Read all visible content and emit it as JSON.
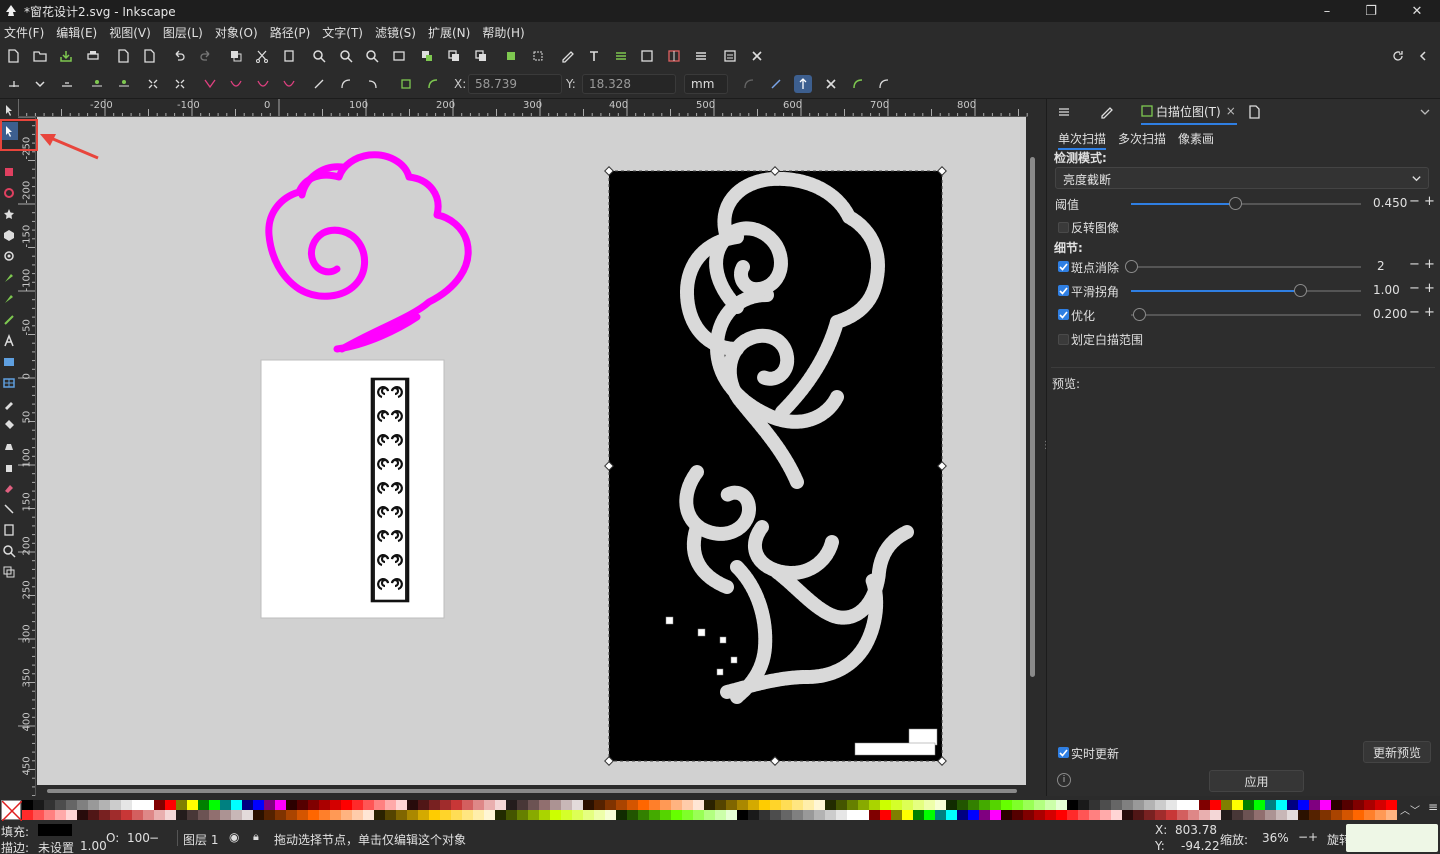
{
  "window": {
    "title": "*窗花设计2.svg - Inkscape",
    "minimize": "–",
    "maximize": "❐",
    "close": "✕"
  },
  "menu": [
    "文件(F)",
    "编辑(E)",
    "视图(V)",
    "图层(L)",
    "对象(O)",
    "路径(P)",
    "文字(T)",
    "滤镜(S)",
    "扩展(N)",
    "帮助(H)"
  ],
  "toolcontrols": {
    "x_label": "X:",
    "x_value": "58.739",
    "y_label": "Y:",
    "y_value": "18.328",
    "unit": "mm"
  },
  "ruler": {
    "h_labels": [
      "-200",
      "-100",
      "0",
      "100",
      "200",
      "300",
      "400",
      "500",
      "600",
      "700",
      "800"
    ],
    "v_labels": [
      "-250",
      "-200",
      "-150",
      "-100",
      "-50",
      "0",
      "50",
      "100",
      "150",
      "200",
      "250",
      "300",
      "350",
      "400",
      "450"
    ]
  },
  "panel": {
    "tabs": [
      "描图",
      "填充与描边",
      "白描位图(T)"
    ],
    "active_tab": "白描位图(T)",
    "tab_close": "×",
    "subtabs": [
      "单次扫描",
      "多次扫描",
      "像素画"
    ],
    "detection_mode_label": "检测模式:",
    "detection_mode_value": "亮度截断",
    "threshold_label": "阈值",
    "threshold_value": "0.450",
    "threshold_level": 0.45,
    "invert_label": "反转图像",
    "invert_checked": false,
    "details_label": "细节:",
    "speckles_label": "斑点消除",
    "speckles_checked": true,
    "speckles_value": "2",
    "smooth_label": "平滑拐角",
    "smooth_checked": true,
    "smooth_value": "1.00",
    "optimize_label": "优化",
    "optimize_checked": true,
    "optimize_value": "0.200",
    "trace_area_label": "划定白描范围",
    "trace_area_checked": false,
    "preview_label": "预览:",
    "live_update_label": "实时更新",
    "live_update_checked": true,
    "update_preview_button": "更新预览",
    "apply_button": "应用"
  },
  "status": {
    "fill_label": "填充:",
    "stroke_label": "描边:",
    "stroke_value": "未设置",
    "stroke_width": "1.00",
    "opacity_label": "O:",
    "opacity_value": "100",
    "layer_label": "图层 1",
    "message": "拖动选择节点，单击仅编辑这个对象",
    "cursor_x_label": "X:",
    "cursor_x": "803.78",
    "cursor_y_label": "Y:",
    "cursor_y": "-94.22",
    "zoom_label": "缩放:",
    "zoom_value": "36%",
    "rotate_label": "旋转"
  },
  "colors": {
    "accent": "#2f7fe3",
    "magenta": "#ff00ff",
    "highlight_red": "#e8453c"
  },
  "palette_colors": [
    "#000000",
    "#1a1a1a",
    "#333333",
    "#4d4d4d",
    "#666666",
    "#808080",
    "#999999",
    "#b3b3b3",
    "#cccccc",
    "#e6e6e6",
    "#ffffff",
    "#ffffff",
    "#800000",
    "#ff0000",
    "#808000",
    "#ffff00",
    "#008000",
    "#00ff00",
    "#008080",
    "#00ffff",
    "#000080",
    "#0000ff",
    "#800080",
    "#ff00ff",
    "#2b0000",
    "#550000",
    "#800000",
    "#aa0000",
    "#d40000",
    "#ff0000",
    "#ff2a2a",
    "#ff5555",
    "#ff8080",
    "#ffaaaa",
    "#ffd5d5",
    "#280b0b",
    "#501616",
    "#782121",
    "#a02c2c",
    "#c83737",
    "#d35f5f",
    "#de8787",
    "#e9afaf",
    "#f4d7d7",
    "#241c1c",
    "#483737",
    "#6c5353",
    "#916f6f",
    "#ac9393",
    "#c8b7b7",
    "#e3dbdb",
    "#2b1100",
    "#552200",
    "#803300",
    "#aa4400",
    "#d45500",
    "#ff6600",
    "#ff7f2a",
    "#ff9955",
    "#ffb380",
    "#ffccaa",
    "#ffe6d5",
    "#2b2200",
    "#554400",
    "#806600",
    "#aa8800",
    "#d4aa00",
    "#ffcc00",
    "#ffd42a",
    "#ffdd55",
    "#ffe680",
    "#ffeeaa",
    "#fff6d5",
    "#222b00",
    "#445500",
    "#668000",
    "#88aa00",
    "#aad400",
    "#ccff00",
    "#d4ff2a",
    "#ddff55",
    "#e5ff80",
    "#eeffaa",
    "#f6ffd5",
    "#112b00",
    "#225500",
    "#338000",
    "#44aa00",
    "#55d400",
    "#66ff00",
    "#7fff2a",
    "#99ff55",
    "#b3ff80",
    "#ccffaa",
    "#e5ffd5"
  ]
}
